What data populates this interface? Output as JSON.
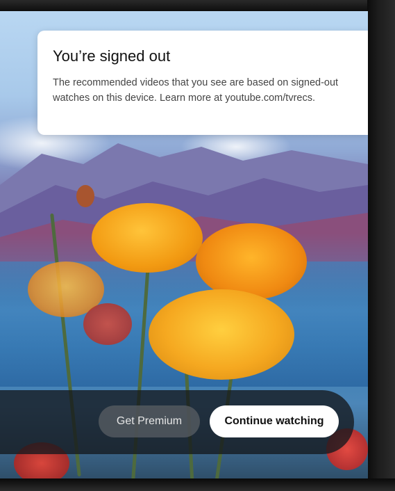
{
  "dialog": {
    "title": "You’re signed out",
    "message": "The recommended videos that you see are based on signed-out watches on this device. Learn more at youtube.com/tvrecs."
  },
  "actions": {
    "premium_label": "Get Premium",
    "continue_label": "Continue watching"
  },
  "colors": {
    "card_background": "#ffffff",
    "primary_button": "#ffffff",
    "secondary_button": "#5a5f64",
    "action_bar": "#14181e"
  }
}
